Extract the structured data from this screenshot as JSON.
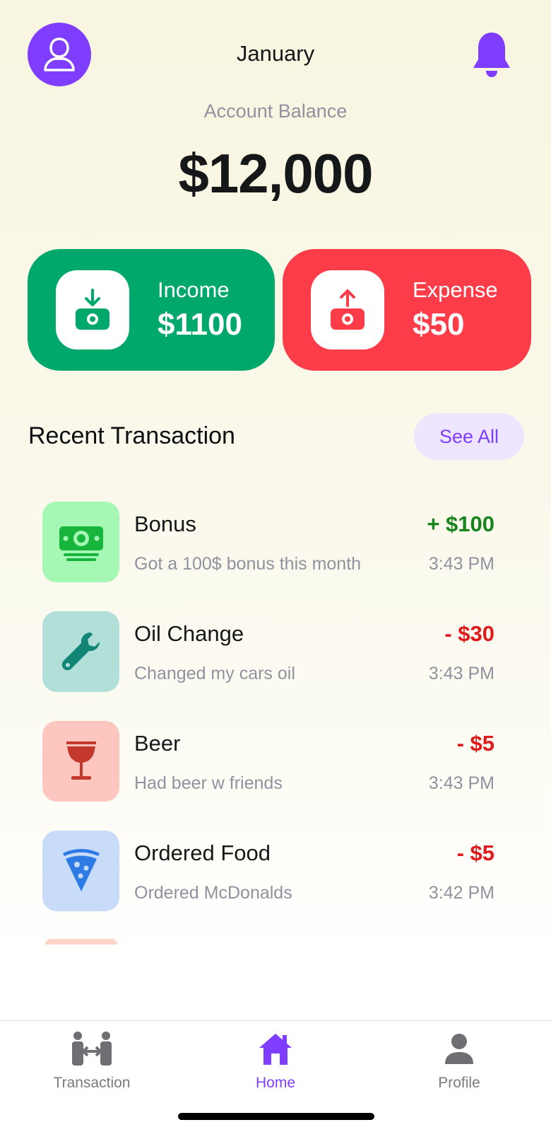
{
  "header": {
    "month": "January",
    "avatar_icon": "user-icon",
    "notification_icon": "bell-icon"
  },
  "balance": {
    "label": "Account Balance",
    "value": "$12,000"
  },
  "summary": {
    "income": {
      "label": "Income",
      "value": "$1100",
      "icon": "money-in-icon",
      "color": "#00a86b"
    },
    "expense": {
      "label": "Expense",
      "value": "$50",
      "icon": "money-out-icon",
      "color": "#fd3c4a"
    }
  },
  "recent": {
    "title": "Recent Transaction",
    "see_all_label": "See All",
    "transactions": [
      {
        "title": "Bonus",
        "description": "Got a 100$ bonus this month",
        "amount": "+ $100",
        "time": "3:43 PM",
        "icon": "cash-icon",
        "icon_bg": "#a5f8b4",
        "type": "income"
      },
      {
        "title": "Oil Change",
        "description": "Changed my cars oil",
        "amount": "- $30",
        "time": "3:43 PM",
        "icon": "wrench-icon",
        "icon_bg": "#b2dfd8",
        "type": "expense"
      },
      {
        "title": "Beer",
        "description": "Had beer w friends",
        "amount": "- $5",
        "time": "3:43 PM",
        "icon": "wine-glass-icon",
        "icon_bg": "#fdc7c0",
        "type": "expense"
      },
      {
        "title": "Ordered Food",
        "description": "Ordered McDonalds",
        "amount": "- $5",
        "time": "3:42 PM",
        "icon": "pizza-icon",
        "icon_bg": "#c8dcfa",
        "type": "expense"
      }
    ]
  },
  "tabbar": {
    "tabs": [
      {
        "label": "Transaction",
        "icon": "transfer-icon",
        "active": false
      },
      {
        "label": "Home",
        "icon": "home-icon",
        "active": true
      },
      {
        "label": "Profile",
        "icon": "person-icon",
        "active": false
      }
    ]
  },
  "colors": {
    "accent": "#7f3dff",
    "income": "#00a86b",
    "expense": "#fd3c4a",
    "positive_amount": "#15841b",
    "negative_amount": "#e01a1a"
  }
}
